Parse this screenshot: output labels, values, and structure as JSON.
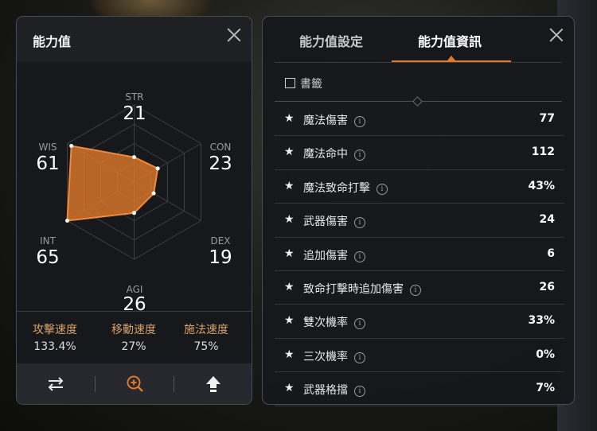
{
  "left_panel": {
    "title": "能力值",
    "stats": {
      "str": {
        "label": "STR",
        "value": 21
      },
      "con": {
        "label": "CON",
        "value": 23
      },
      "dex": {
        "label": "DEX",
        "value": 19
      },
      "agi": {
        "label": "AGI",
        "value": 26
      },
      "int": {
        "label": "INT",
        "value": 65
      },
      "wis": {
        "label": "WIS",
        "value": 61
      }
    },
    "speeds": [
      {
        "label": "攻擊速度",
        "value": "133.4%"
      },
      {
        "label": "移動速度",
        "value": "27%"
      },
      {
        "label": "施法速度",
        "value": "75%"
      }
    ],
    "bottom_icons": [
      "swap-arrows-icon",
      "zoom-in-icon",
      "upload-arrow-icon"
    ],
    "accent_color": "#e07a2a"
  },
  "right_panel": {
    "tabs": [
      {
        "label": "能力值設定",
        "active": false
      },
      {
        "label": "能力值資訊",
        "active": true
      }
    ],
    "bookmark_label": "書籤",
    "info_icon_glyph": "i",
    "star_glyph": "★",
    "rows": [
      {
        "name": "魔法傷害",
        "value": "77"
      },
      {
        "name": "魔法命中",
        "value": "112"
      },
      {
        "name": "魔法致命打擊",
        "value": "43%"
      },
      {
        "name": "武器傷害",
        "value": "24"
      },
      {
        "name": "追加傷害",
        "value": "6"
      },
      {
        "name": "致命打擊時追加傷害",
        "value": "26"
      },
      {
        "name": "雙次機率",
        "value": "33%"
      },
      {
        "name": "三次機率",
        "value": "0%"
      },
      {
        "name": "武器格擋",
        "value": "7%"
      }
    ]
  }
}
